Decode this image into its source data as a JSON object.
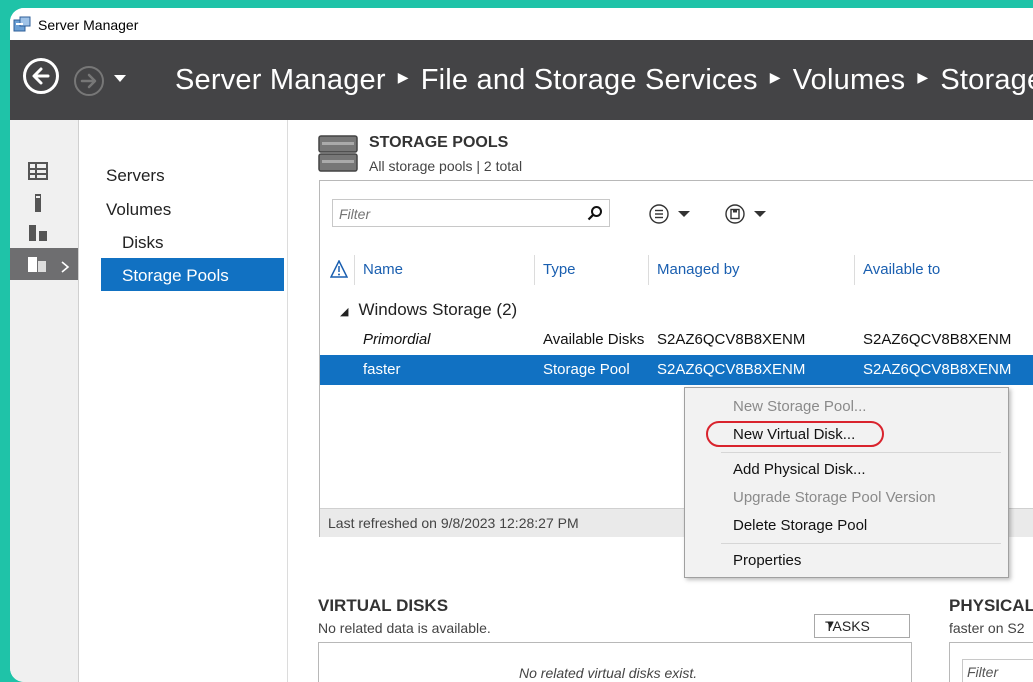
{
  "window": {
    "title": "Server Manager"
  },
  "breadcrumb": {
    "items": [
      "Server Manager",
      "File and Storage Services",
      "Volumes",
      "Storage"
    ]
  },
  "sidebar": {
    "items": [
      {
        "label": "Servers"
      },
      {
        "label": "Volumes"
      },
      {
        "label": "Disks"
      },
      {
        "label": "Storage Pools",
        "selected": true
      }
    ]
  },
  "storage_pools": {
    "title": "STORAGE POOLS",
    "subtitle": "All storage pools | 2 total",
    "filter_placeholder": "Filter",
    "columns": [
      "Name",
      "Type",
      "Managed by",
      "Available to"
    ],
    "group": {
      "label": "Windows Storage (2)"
    },
    "rows": [
      {
        "name": "Primordial",
        "type": "Available Disks",
        "managed_by": "S2AZ6QCV8B8XENM",
        "available_to": "S2AZ6QCV8B8XENM",
        "selected": false
      },
      {
        "name": "faster",
        "type": "Storage Pool",
        "managed_by": "S2AZ6QCV8B8XENM",
        "available_to": "S2AZ6QCV8B8XENM",
        "selected": true
      }
    ],
    "last_refreshed": "Last refreshed on 9/8/2023 12:28:27 PM"
  },
  "context_menu": {
    "items": [
      {
        "label": "New Storage Pool...",
        "enabled": false
      },
      {
        "label": "New Virtual Disk...",
        "enabled": true,
        "highlighted": true
      },
      {
        "label": "Add Physical Disk...",
        "enabled": true
      },
      {
        "label": "Upgrade Storage Pool Version",
        "enabled": false
      },
      {
        "label": "Delete Storage Pool",
        "enabled": true
      },
      {
        "label": "Properties",
        "enabled": true
      }
    ]
  },
  "virtual_disks": {
    "title": "VIRTUAL DISKS",
    "subtitle": "No related data is available.",
    "tasks_label": "TASKS",
    "empty_message": "No related virtual disks exist."
  },
  "physical_disks": {
    "title": "PHYSICAL",
    "subtitle": "faster on S2",
    "filter_placeholder": "Filter"
  },
  "colors": {
    "accent": "#1171c2",
    "navbar": "#444446",
    "frame": "#1fc3a8",
    "highlight_ring": "#d9232d"
  }
}
